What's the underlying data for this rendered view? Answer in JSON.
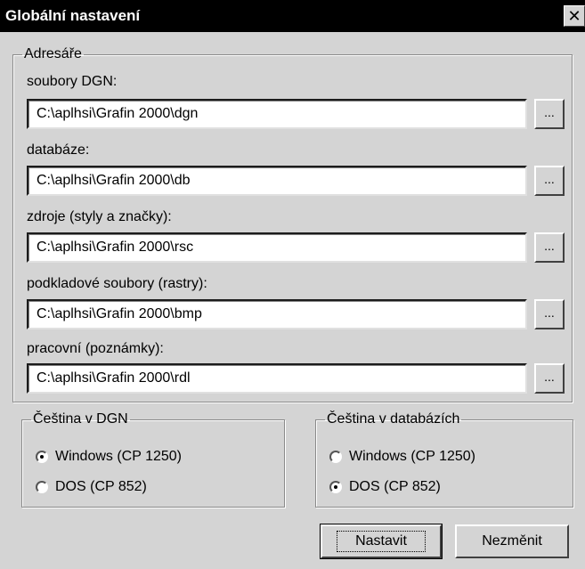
{
  "window": {
    "title": "Globální nastavení",
    "close_glyph": "✕"
  },
  "directories": {
    "legend": "Adresáře",
    "browse_label": "...",
    "items": [
      {
        "label": "soubory DGN:",
        "value": "C:\\aplhsi\\Grafin 2000\\dgn"
      },
      {
        "label": "databáze:",
        "value": "C:\\aplhsi\\Grafin 2000\\db"
      },
      {
        "label": "zdroje (styly a značky):",
        "value": "C:\\aplhsi\\Grafin 2000\\rsc"
      },
      {
        "label": "podkladové soubory (rastry):",
        "value": "C:\\aplhsi\\Grafin 2000\\bmp"
      },
      {
        "label": "pracovní (poznámky):",
        "value": "C:\\aplhsi\\Grafin 2000\\rdl"
      }
    ]
  },
  "czech_dgn": {
    "legend": "Čeština v DGN",
    "options": [
      {
        "label": "Windows (CP 1250)",
        "selected": true
      },
      {
        "label": "DOS (CP 852)",
        "selected": false
      }
    ]
  },
  "czech_db": {
    "legend": "Čeština v databázích",
    "options": [
      {
        "label": "Windows (CP 1250)",
        "selected": false
      },
      {
        "label": "DOS (CP 852)",
        "selected": true
      }
    ]
  },
  "buttons": {
    "apply": "Nastavit",
    "cancel": "Nezměnit"
  }
}
